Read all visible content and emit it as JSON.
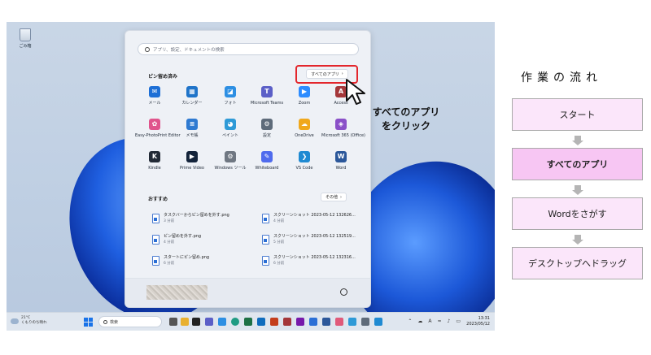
{
  "desktop": {
    "recycle_label": "ごみ箱"
  },
  "start_menu": {
    "search_placeholder": "アプリ、設定、ドキュメントの検索",
    "pinned_title": "ピン留め済み",
    "all_apps_label": "すべてのアプリ",
    "all_apps_chevron": "›",
    "pinned_apps": [
      {
        "label": "メール",
        "icon": "mail-icon",
        "color": "#1d6fd6",
        "glyph": "✉"
      },
      {
        "label": "カレンダー",
        "icon": "calendar-icon",
        "color": "#1f74c9",
        "glyph": "▦"
      },
      {
        "label": "フォト",
        "icon": "photos-icon",
        "color": "#2d8fe3",
        "glyph": "◪"
      },
      {
        "label": "Microsoft Teams",
        "icon": "teams-icon",
        "color": "#5b5fc7",
        "glyph": "T"
      },
      {
        "label": "Zoom",
        "icon": "zoom-icon",
        "color": "#2d8cff",
        "glyph": "▶"
      },
      {
        "label": "Access",
        "icon": "access-icon",
        "color": "#a4373a",
        "glyph": "A"
      },
      {
        "label": "Easy-PhotoPrint Editor",
        "icon": "photoprint-icon",
        "color": "#e0548c",
        "glyph": "✿"
      },
      {
        "label": "メモ帳",
        "icon": "notepad-icon",
        "color": "#2f7ad1",
        "glyph": "≡"
      },
      {
        "label": "ペイント",
        "icon": "paint-icon",
        "color": "#2e9ad7",
        "glyph": "◕"
      },
      {
        "label": "設定",
        "icon": "settings-icon",
        "color": "#5e6b7a",
        "glyph": "⚙"
      },
      {
        "label": "OneDrive",
        "icon": "onedrive-icon",
        "color": "#f0a81c",
        "glyph": "☁"
      },
      {
        "label": "Microsoft 365 (Office)",
        "icon": "office-icon",
        "color": "#8a50c8",
        "glyph": "◈"
      },
      {
        "label": "Kindle",
        "icon": "kindle-icon",
        "color": "#222a36",
        "glyph": "K"
      },
      {
        "label": "Prime Video",
        "icon": "primevideo-icon",
        "color": "#13233a",
        "glyph": "▶"
      },
      {
        "label": "Windows ツール",
        "icon": "windows-tools-icon",
        "color": "#6f7782",
        "glyph": "⚙"
      },
      {
        "label": "Whiteboard",
        "icon": "whiteboard-icon",
        "color": "#4f6bed",
        "glyph": "✎"
      },
      {
        "label": "VS Code",
        "icon": "vscode-icon",
        "color": "#1f8ad2",
        "glyph": "❯"
      },
      {
        "label": "Word",
        "icon": "word-icon",
        "color": "#2b579a",
        "glyph": "W"
      }
    ],
    "recommended_title": "おすすめ",
    "more_label": "その他",
    "more_chevron": "›",
    "recommended": [
      {
        "name": "タスクバーからピン留めを外す.png",
        "time": "3 分前"
      },
      {
        "name": "スクリーンショット 2023-05-12 132626...",
        "time": "4 分前"
      },
      {
        "name": "ピン留めを外す.png",
        "time": "4 分前"
      },
      {
        "name": "スクリーンショット 2023-05-12 132519...",
        "time": "5 分前"
      },
      {
        "name": "スタートにピン留め.png",
        "time": "6 分前"
      },
      {
        "name": "スクリーンショット 2023-05-12 132316...",
        "time": "6 分前"
      }
    ]
  },
  "callout": {
    "line1": "すべてのアプリ",
    "line2": "をクリック"
  },
  "taskbar": {
    "temperature": "21°C",
    "weather_text": "くもりのち晴れ",
    "search_placeholder": "検索",
    "ime": "A",
    "time": "13:31",
    "date": "2023/05/12"
  },
  "flow": {
    "title": "作業の流れ",
    "steps": [
      "スタート",
      "すべてのアプリ",
      "Wordをさがす",
      "デスクトップへドラッグ"
    ]
  }
}
